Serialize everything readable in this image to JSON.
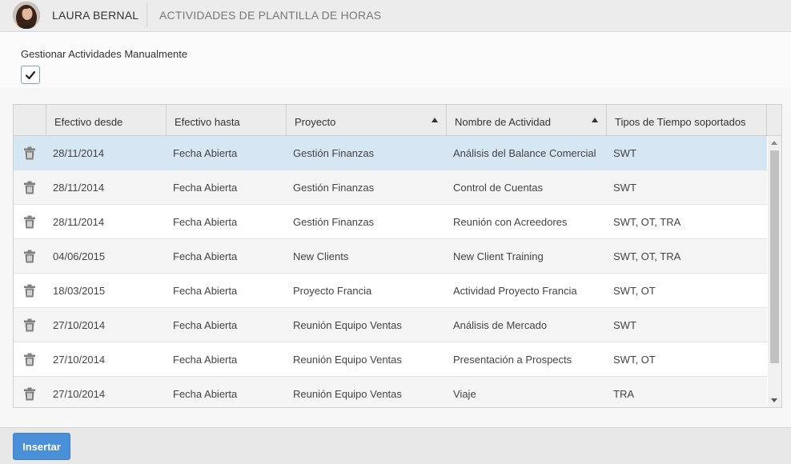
{
  "header": {
    "user_name": "LAURA BERNAL",
    "page_title": "ACTIVIDADES DE PLANTILLA DE HORAS"
  },
  "manage": {
    "label": "Gestionar Actividades Manualmente",
    "checked": true
  },
  "table": {
    "columns": [
      "Efectivo desde",
      "Efectivo hasta",
      "Proyecto",
      "Nombre de Actividad",
      "Tipos de Tiempo soportados"
    ],
    "sorted_columns": [
      "Proyecto",
      "Nombre de Actividad"
    ],
    "selected_row": 0,
    "rows": [
      {
        "desde": "28/11/2014",
        "hasta": "Fecha Abierta",
        "proyecto": "Gestión Finanzas",
        "actividad": "Análisis del Balance Comercial",
        "tipos": "SWT"
      },
      {
        "desde": "28/11/2014",
        "hasta": "Fecha Abierta",
        "proyecto": "Gestión Finanzas",
        "actividad": "Control de Cuentas",
        "tipos": "SWT"
      },
      {
        "desde": "28/11/2014",
        "hasta": "Fecha Abierta",
        "proyecto": "Gestión Finanzas",
        "actividad": "Reunión con Acreedores",
        "tipos": "SWT, OT, TRA"
      },
      {
        "desde": "04/06/2015",
        "hasta": "Fecha Abierta",
        "proyecto": "New Clients",
        "actividad": "New Client Training",
        "tipos": "SWT, OT, TRA"
      },
      {
        "desde": "18/03/2015",
        "hasta": "Fecha Abierta",
        "proyecto": "Proyecto Francia",
        "actividad": "Actividad Proyecto Francia",
        "tipos": "SWT, OT"
      },
      {
        "desde": "27/10/2014",
        "hasta": "Fecha Abierta",
        "proyecto": "Reunión Equipo Ventas",
        "actividad": "Análisis de Mercado",
        "tipos": "SWT"
      },
      {
        "desde": "27/10/2014",
        "hasta": "Fecha Abierta",
        "proyecto": "Reunión Equipo Ventas",
        "actividad": "Presentación a Prospects",
        "tipos": "SWT, OT"
      },
      {
        "desde": "27/10/2014",
        "hasta": "Fecha Abierta",
        "proyecto": "Reunión Equipo Ventas",
        "actividad": "Viaje",
        "tipos": "TRA"
      }
    ]
  },
  "footer": {
    "insert_label": "Insertar"
  },
  "colors": {
    "accent": "#4a90d9",
    "selected_row": "#d6e6f3",
    "header_bg": "#ececec"
  },
  "icons": {
    "row_action": "trash-icon",
    "checkbox": "check-icon"
  }
}
